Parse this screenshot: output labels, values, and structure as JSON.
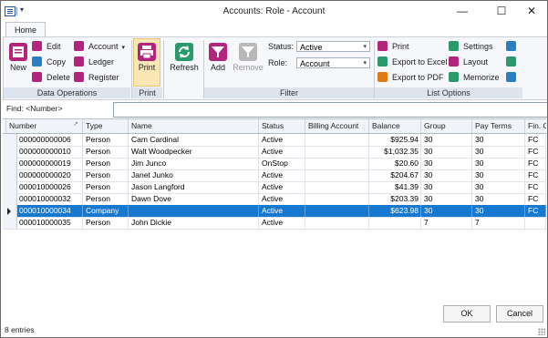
{
  "window": {
    "title": "Accounts: Role - Account",
    "minimize": "—",
    "maximize": "☐",
    "close": "✕"
  },
  "ribbon": {
    "tab": "Home",
    "groups": {
      "data_operations": "Data Operations",
      "print": "Print",
      "filter": "Filter",
      "list_options": "List Options"
    },
    "buttons": {
      "new": "New",
      "edit": "Edit",
      "copy": "Copy",
      "delete": "Delete",
      "account": "Account",
      "ledger": "Ledger",
      "register": "Register",
      "print": "Print",
      "refresh": "Refresh",
      "add": "Add",
      "remove": "Remove",
      "print_list": "Print",
      "export_excel": "Export to Excel",
      "export_pdf": "Export to PDF",
      "settings": "Settings",
      "layout": "Layout",
      "memorize": "Memorize"
    },
    "filter": {
      "status_label": "Status:",
      "status_value": "Active",
      "role_label": "Role:",
      "role_value": "Account"
    }
  },
  "find": {
    "label": "Find: <Number>",
    "value": ""
  },
  "grid": {
    "columns": [
      "Number",
      "Type",
      "Name",
      "Status",
      "Billing Account",
      "Balance",
      "Group",
      "Pay Terms",
      "Fin. C"
    ],
    "rows": [
      [
        "000000000006",
        "Person",
        "Cam Cardinal",
        "Active",
        "",
        "$925.94",
        "30",
        "30",
        "FC"
      ],
      [
        "000000000010",
        "Person",
        "Walt Woodpecker",
        "Active",
        "",
        "$1,032.35",
        "30",
        "30",
        "FC"
      ],
      [
        "000000000019",
        "Person",
        "Jim Junco",
        "OnStop",
        "",
        "$20.60",
        "30",
        "30",
        "FC"
      ],
      [
        "000000000020",
        "Person",
        "Janet Junko",
        "Active",
        "",
        "$204.67",
        "30",
        "30",
        "FC"
      ],
      [
        "000010000026",
        "Person",
        "Jason Langford",
        "Active",
        "",
        "$41.39",
        "30",
        "30",
        "FC"
      ],
      [
        "000010000032",
        "Person",
        "Dawn Dove",
        "Active",
        "",
        "$203.39",
        "30",
        "30",
        "FC"
      ],
      [
        "000010000034",
        "Company",
        "",
        "Active",
        "",
        "$623.98",
        "30",
        "30",
        "FC"
      ],
      [
        "000010000035",
        "Person",
        "John Dickie",
        "Active",
        "",
        "",
        "7",
        "7",
        ""
      ]
    ]
  },
  "footer": {
    "status": "8 entries",
    "ok": "OK",
    "cancel": "Cancel"
  }
}
